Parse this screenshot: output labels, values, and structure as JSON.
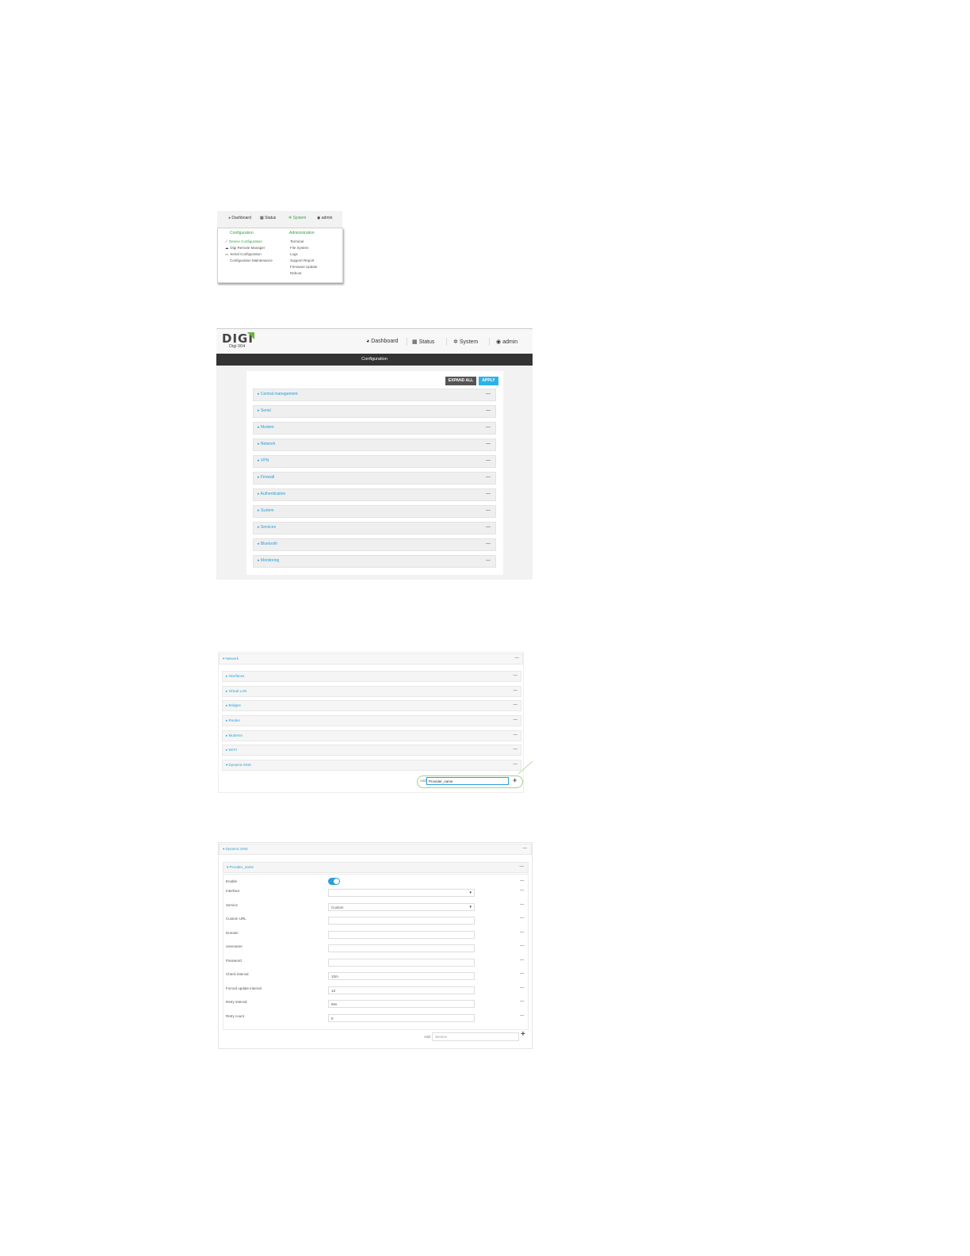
{
  "menu_screenshot": {
    "nav": {
      "dashboard": "Dashboard",
      "status": "Status",
      "system": "System",
      "user": "admin"
    },
    "configuration": {
      "heading": "Configuration",
      "items": [
        "Device Configuration",
        "Digi Remote Manager",
        "Serial Configuration",
        "Configuration Maintenance"
      ]
    },
    "administration": {
      "heading": "Administration",
      "items": [
        "Terminal",
        "File System",
        "Logs",
        "Support Report",
        "Firmware Update",
        "Reboot"
      ]
    }
  },
  "config_screenshot": {
    "logo": "DIGI",
    "logo_sub": "Digi 004",
    "nav": {
      "dashboard": "Dashboard",
      "status": "Status",
      "system": "System",
      "user": "admin"
    },
    "page_title": "Configuration",
    "expand_all": "EXPAND ALL",
    "apply": "APPLY",
    "sections": [
      "Central management",
      "Serial",
      "Modem",
      "Network",
      "VPN",
      "Firewall",
      "Authentication",
      "System",
      "Services",
      "Bluetooth",
      "Monitoring"
    ],
    "section_marker": "▸",
    "collapse": "—"
  },
  "network_screenshot": {
    "parent": "Network",
    "children": [
      "Interfaces",
      "Virtual LAN",
      "Bridges",
      "Routes",
      "Modems",
      "Wi-Fi",
      "Dynamic DNS"
    ],
    "add_label": "Add",
    "add_value": "Provider_name",
    "collapse": "—"
  },
  "ddns_screenshot": {
    "parent": "Dynamic DNS",
    "child": "Provider_name",
    "fields": [
      {
        "label": "Enable",
        "value": ""
      },
      {
        "label": "Interface",
        "value": ""
      },
      {
        "label": "Service",
        "value": "Custom"
      },
      {
        "label": "Custom URL",
        "value": ""
      },
      {
        "label": "Domain",
        "value": ""
      },
      {
        "label": "Username",
        "value": ""
      },
      {
        "label": "Password",
        "value": ""
      },
      {
        "label": "Check interval",
        "value": "10m"
      },
      {
        "label": "Forced update interval",
        "value": "1d"
      },
      {
        "label": "Retry interval",
        "value": "60s"
      },
      {
        "label": "Retry count",
        "value": "5"
      }
    ],
    "add_label": "Add",
    "add_placeholder": "Service",
    "collapse": "—"
  },
  "colors": {
    "accent_blue": "#2b9fd8",
    "menu_green": "#3aa04a",
    "titlebar": "#333333"
  },
  "icons": [
    "dashboard-icon",
    "status-grid-icon",
    "gear-icon",
    "user-icon",
    "wrench-icon",
    "cloud-icon",
    "serial-icon",
    "plus-icon",
    "dropdown-caret-icon",
    "toggle-switch"
  ]
}
